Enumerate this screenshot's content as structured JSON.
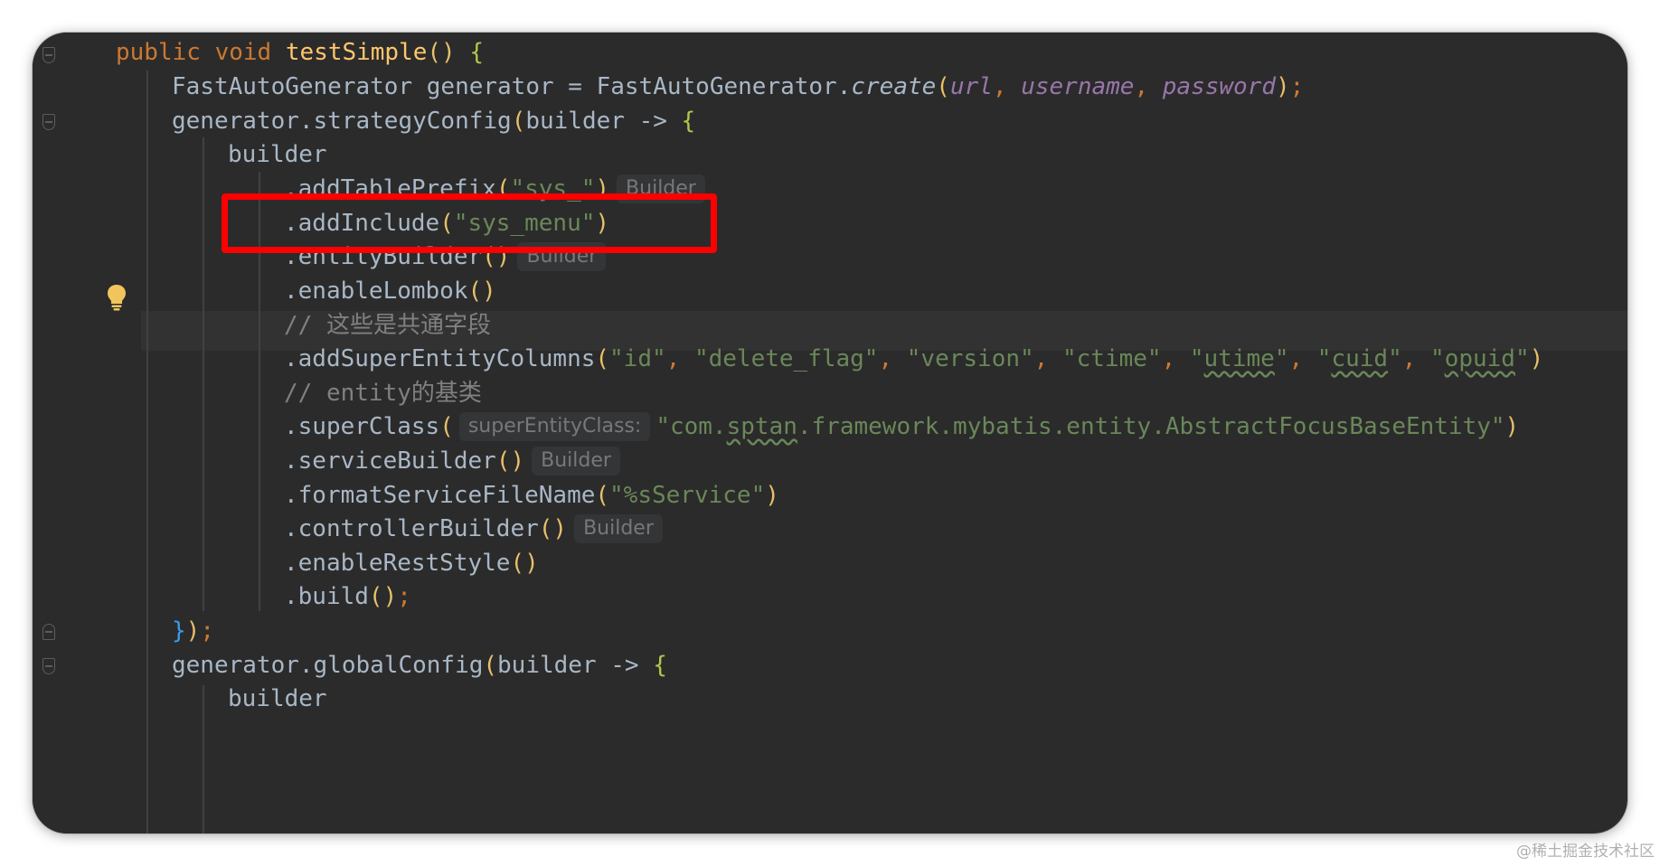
{
  "code": {
    "l1": {
      "kw": "public void ",
      "fn": "testSimple",
      "paren": "()",
      "sp": " ",
      "brace": "{"
    },
    "l2": {
      "a": "FastAutoGenerator generator = FastAutoGenerator.",
      "create": "create",
      "open": "(",
      "url": "url",
      "c1": ", ",
      "username": "username",
      "c2": ", ",
      "password": "password",
      "close": ")",
      "semi": ";"
    },
    "l3": {
      "a": "generator.strategyConfig",
      "open": "(",
      "b": "builder -> ",
      "brace": "{"
    },
    "l4": {
      "a": "builder"
    },
    "l5": {
      "a": ".addTablePrefix",
      "open": "(",
      "str": "\"sys_\"",
      "close": ")",
      "hint": "Builder"
    },
    "l6": {
      "a": ".addInclude",
      "open": "(",
      "str": "\"sys_menu\"",
      "close": ")"
    },
    "l7": {
      "a": ".entityBuilder",
      "paren": "()",
      "hint": "Builder"
    },
    "l8": {
      "a": ".enableLombok",
      "paren": "()"
    },
    "l9": {
      "comment": "// 这些是共通字段"
    },
    "l10": {
      "a": ".addSuperEntityColumns",
      "open": "(",
      "s1": "\"id\"",
      "c1": ", ",
      "s2": "\"delete_flag\"",
      "c2": ", ",
      "s3": "\"version\"",
      "c3": ", ",
      "s4": "\"ctime\"",
      "c4": ", ",
      "s5q": "\"",
      "s5": "utime",
      "s5e": "\"",
      "c5": ", ",
      "s6q": "\"",
      "s6": "cuid",
      "s6e": "\"",
      "c6": ", ",
      "s7q": "\"",
      "s7": "opuid",
      "s7e": "\"",
      "close": ")"
    },
    "l11": {
      "comment": "// entity的基类"
    },
    "l12": {
      "a": ".superClass",
      "open": "(",
      "hint": "superEntityClass:",
      "s1": "\"com.",
      "s2": "sptan",
      "s3": ".framework.mybatis.entity.AbstractFocusBaseEntity\"",
      "close": ")"
    },
    "l13": {
      "a": ".serviceBuilder",
      "paren": "()",
      "hint": "Builder"
    },
    "l14": {
      "a": ".formatServiceFileName",
      "open": "(",
      "str": "\"%sService\"",
      "close": ")"
    },
    "l15": {
      "a": ".controllerBuilder",
      "paren": "()",
      "hint": "Builder"
    },
    "l16": {
      "a": ".enableRestStyle",
      "paren": "()"
    },
    "l17": {
      "a": ".build",
      "paren": "()",
      "semi": ";"
    },
    "l18": {
      "brace": "}",
      "paren": ")",
      "semi": ";"
    },
    "l19": {
      "a": "generator.globalConfig",
      "open": "(",
      "b": "builder -> ",
      "brace": "{"
    },
    "l20": {
      "a": "builder"
    }
  },
  "colors": {
    "background": "#2b2b2b",
    "keyword": "#cc7832",
    "method": "#ffc66d",
    "string": "#6a8759",
    "comment": "#808080",
    "parameter": "#9876aa",
    "highlight_box": "#ff0000"
  },
  "icons": {
    "gutter": "lightbulb-icon",
    "fold": "fold-marker-icon"
  },
  "watermark": "@稀土掘金技术社区"
}
